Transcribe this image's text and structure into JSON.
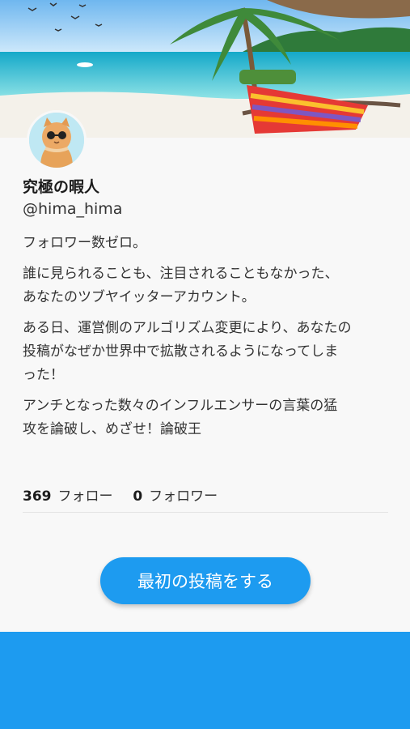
{
  "header": {
    "image": "beach-hammock-scene"
  },
  "profile": {
    "avatar": "cat-with-sunglasses-avatar",
    "display_name": "究極の暇人",
    "handle": "@hima_hima",
    "bio": [
      "フォロワー数ゼロ。",
      "誰に見られることも、注目されることもなかった、\nあなたのツブヤイッターアカウント。",
      "ある日、運営側のアルゴリズム変更により、あなたの\n投稿がなぜか世界中で拡散されるようになってしま\nった！",
      "アンチとなった数々のインフルエンサーの言葉の猛\n攻を論破し、めざせ！論破王"
    ],
    "following_count": "369",
    "following_label": "フォロー",
    "followers_count": "0",
    "followers_label": "フォロワー"
  },
  "actions": {
    "first_post_label": "最初の投稿をする"
  },
  "colors": {
    "accent": "#1d9bf0",
    "background": "#f8f8f8"
  }
}
